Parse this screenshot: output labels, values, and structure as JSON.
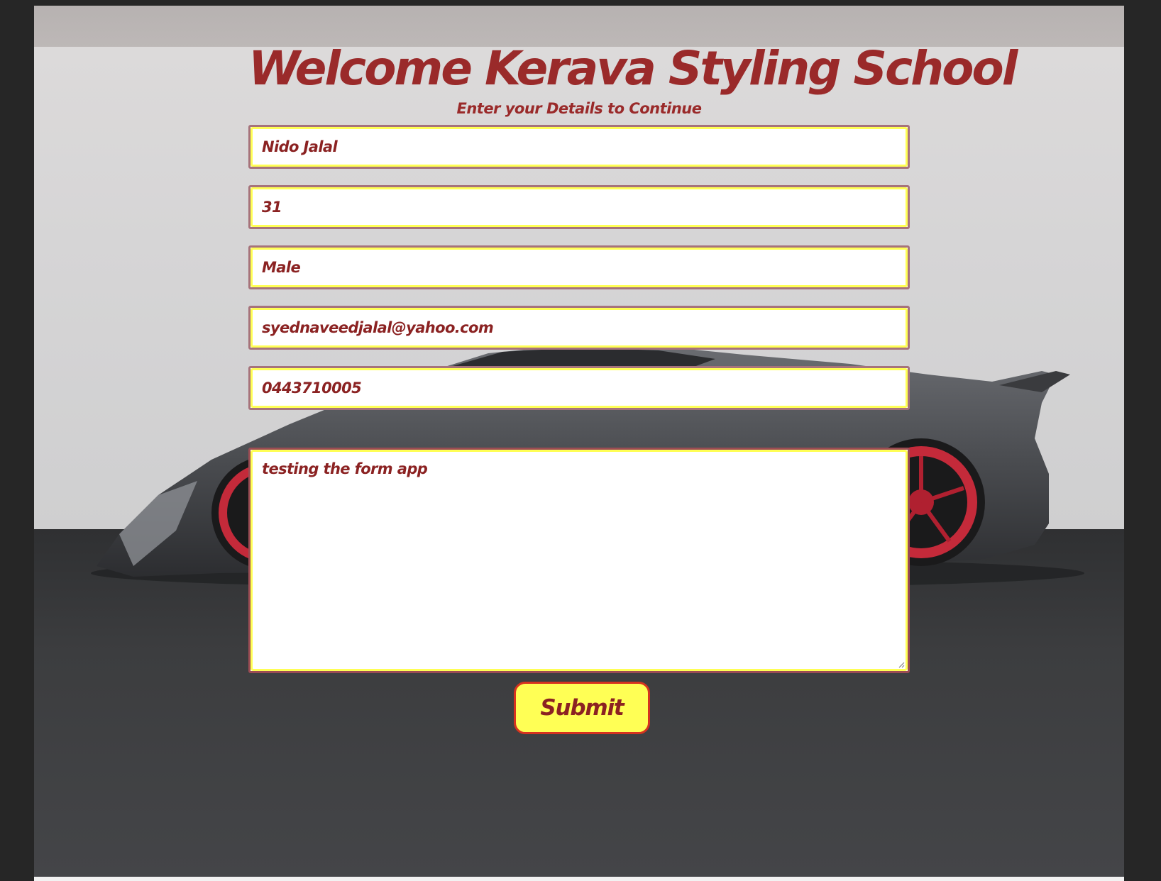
{
  "header": {
    "title": "Welcome Kerava Styling School",
    "subtitle": "Enter your Details to Continue"
  },
  "form": {
    "fields": [
      {
        "value": "Nido Jalal"
      },
      {
        "value": "31"
      },
      {
        "value": "Male"
      },
      {
        "value": "syednaveedjalal@yahoo.com"
      },
      {
        "value": "0443710005"
      }
    ],
    "message": "testing the form app",
    "submit_label": "Submit"
  },
  "colors": {
    "accent_text": "#9a2a2a",
    "field_highlight": "#ffff55",
    "button_border": "#d6331f"
  },
  "background": {
    "image": "sports-car-icon"
  }
}
